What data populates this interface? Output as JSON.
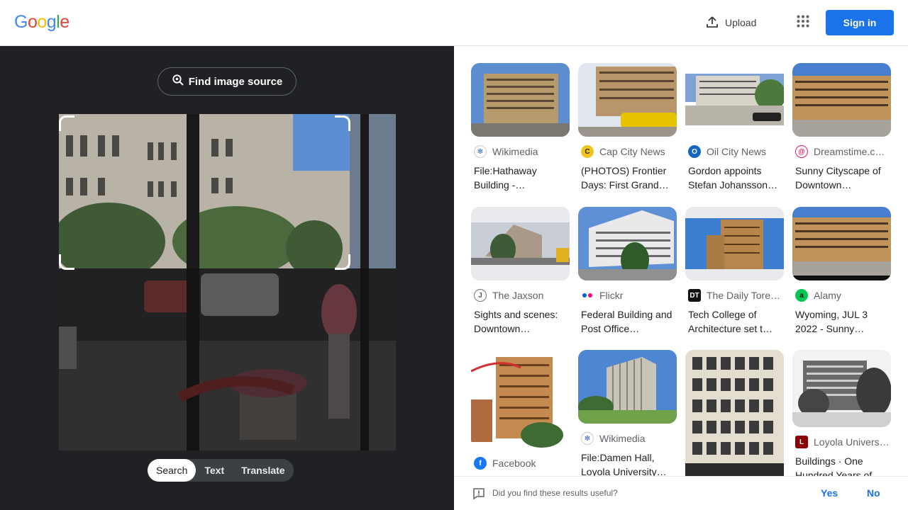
{
  "header": {
    "logo": "Google",
    "upload_label": "Upload",
    "signin_label": "Sign in"
  },
  "lens": {
    "find_source_label": "Find image source",
    "modes": [
      "Search",
      "Text",
      "Translate"
    ],
    "active_mode": "Search"
  },
  "results": [
    {
      "source": "Wikimedia",
      "title": "File:Hathaway Building -…",
      "icon": "wikimedia-icon",
      "icon_color": "#3366cc"
    },
    {
      "source": "Cap City News",
      "title": "(PHOTOS) Frontier Days: First Grand…",
      "icon": "capcity-icon",
      "icon_color": "#f0c419"
    },
    {
      "source": "Oil City News",
      "title": "Gordon appoints Stefan Johansson…",
      "icon": "oilcity-icon",
      "icon_color": "#1565c0"
    },
    {
      "source": "Dreamstime.c…",
      "title": "Sunny Cityscape of Downtown…",
      "icon": "dreamstime-icon",
      "icon_color": "#e91e63"
    },
    {
      "source": "The Jaxson",
      "title": "Sights and scenes: Downtown…",
      "icon": "jaxson-icon",
      "icon_color": "#555555"
    },
    {
      "source": "Flickr",
      "title": "Federal Building and Post Office…",
      "icon": "flickr-icon",
      "icon_color": "#ff0084"
    },
    {
      "source": "The Daily Tore…",
      "title": "Tech College of Architecture set t…",
      "icon": "dailytoreador-icon",
      "icon_color": "#111111"
    },
    {
      "source": "Alamy",
      "title": "Wyoming, JUL 3 2022 - Sunny…",
      "icon": "alamy-icon",
      "icon_color": "#00c853"
    },
    {
      "source": "Facebook",
      "title": "",
      "icon": "facebook-icon",
      "icon_color": "#1877f2"
    },
    {
      "source": "Wikimedia",
      "title": "File:Damen Hall, Loyola University…",
      "icon": "wikimedia-icon",
      "icon_color": "#3366cc"
    },
    {
      "source": "",
      "title": "",
      "icon": "",
      "icon_color": ""
    },
    {
      "source": "Loyola Univers…",
      "title": "Buildings · One Hundred Years of…",
      "icon": "loyola-icon",
      "icon_color": "#8b0000"
    }
  ],
  "feedback": {
    "question": "Did you find these results useful?",
    "yes": "Yes",
    "no": "No"
  },
  "colors": {
    "brand_blue": "#1a73e8",
    "left_bg": "#202124",
    "logo_blue": "#4285F4",
    "logo_red": "#EA4335",
    "logo_yellow": "#FBBC05",
    "logo_green": "#34A853"
  }
}
